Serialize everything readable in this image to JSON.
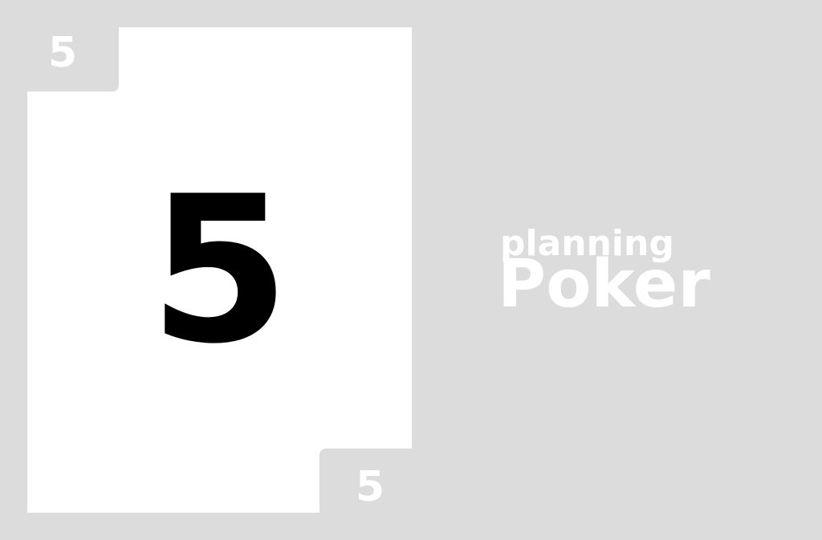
{
  "card": {
    "value": "5",
    "corner_top_left": "5",
    "corner_bottom_right": "5"
  },
  "logo": {
    "line1": "planning",
    "line2": "Poker"
  },
  "colors": {
    "background": "#dcdcdc",
    "card": "#ffffff",
    "card_value": "#000000",
    "logo_text": "#ffffff"
  }
}
